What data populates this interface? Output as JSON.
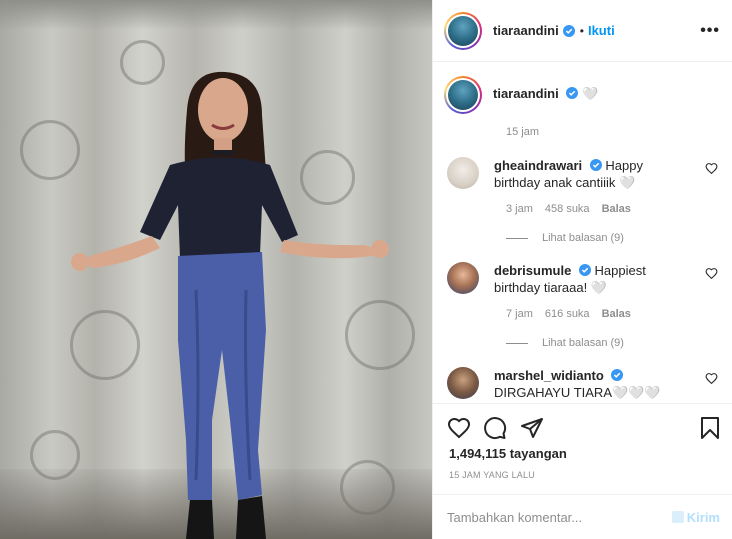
{
  "header": {
    "username": "tiaraandini",
    "separator": "•",
    "follow_label": "Ikuti",
    "more_label": "•••"
  },
  "caption": {
    "username": "tiaraandini",
    "text": "🤍",
    "time": "15 jam"
  },
  "comments": [
    {
      "username": "gheaindrawari",
      "text": "Happy birthday anak cantiiik 🤍",
      "time": "3 jam",
      "likes": "458 suka",
      "reply_label": "Balas",
      "view_replies": "Lihat balasan (9)"
    },
    {
      "username": "debrisumule",
      "text": "Happiest birthday tiaraaa! 🤍",
      "time": "7 jam",
      "likes": "616 suka",
      "reply_label": "Balas",
      "view_replies": "Lihat balasan (9)"
    },
    {
      "username": "marshel_widianto",
      "text": "DIRGAHAYU TIARA🤍🤍🤍",
      "time": "",
      "likes": "",
      "reply_label": "",
      "view_replies": ""
    }
  ],
  "stats": {
    "views": "1,494,115 tayangan",
    "ago": "15 JAM YANG LALU"
  },
  "composer": {
    "placeholder": "Tambahkan komentar...",
    "post_label": "Kirim"
  },
  "colors": {
    "accent": "#0095f6",
    "verified": "#3897f0",
    "muted": "#8e8e8e",
    "post_disabled": "#b2dffc"
  },
  "icons": {
    "like": "heart-icon",
    "comment": "comment-icon",
    "share": "paper-plane-icon",
    "save": "bookmark-icon",
    "more": "more-dots-icon",
    "verified": "verified-badge-icon"
  }
}
